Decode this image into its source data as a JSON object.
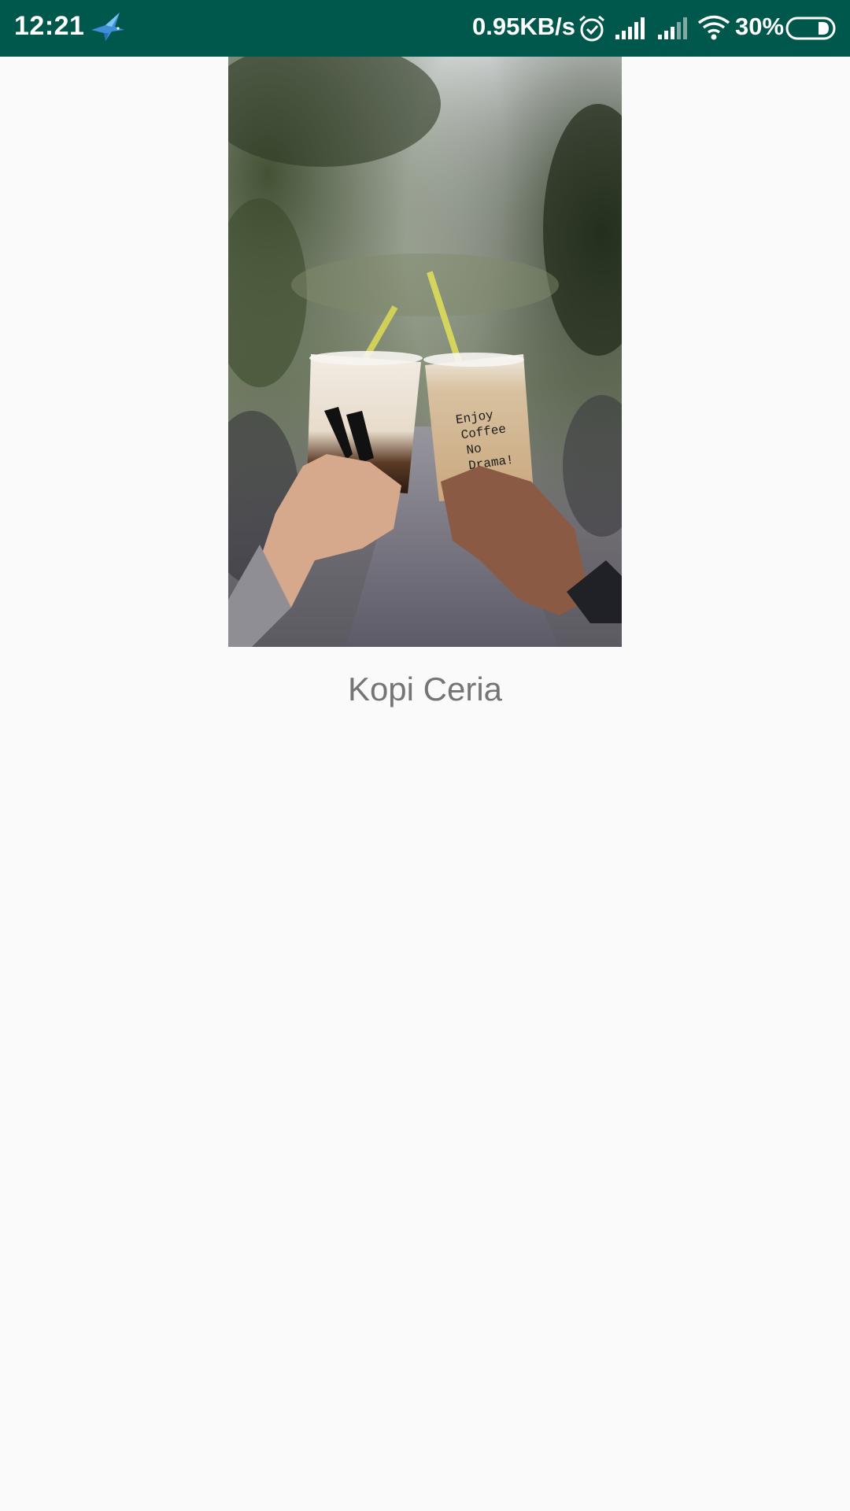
{
  "status_bar": {
    "time": "12:21",
    "net_speed": "0.95KB/s",
    "battery_percent": "30%",
    "background_color": "#00574b",
    "icons": [
      "bird-icon",
      "alarm-icon",
      "signal-icon",
      "signal-icon",
      "wifi-icon",
      "battery-icon"
    ],
    "battery_level": 0.3
  },
  "main": {
    "image_alt": "Two hands toasting iced coffee cups",
    "cup_text": "Enjoy Coffee No Drama!",
    "caption": "Kopi Ceria",
    "caption_color": "#757575"
  }
}
